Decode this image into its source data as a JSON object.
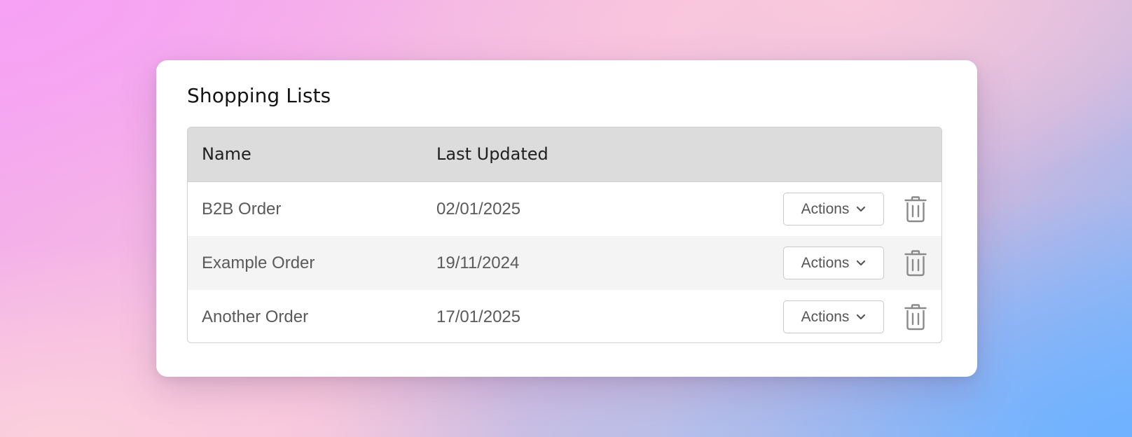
{
  "card": {
    "title": "Shopping Lists"
  },
  "table": {
    "columns": {
      "name": "Name",
      "last_updated": "Last Updated"
    },
    "rows": [
      {
        "name": "B2B Order",
        "last_updated": "02/01/2025",
        "action_label": "Actions"
      },
      {
        "name": "Example Order",
        "last_updated": "19/11/2024",
        "action_label": "Actions"
      },
      {
        "name": "Another Order",
        "last_updated": "17/01/2025",
        "action_label": "Actions"
      }
    ]
  },
  "icons": {
    "dropdown": "chevron-down-icon",
    "delete": "trash-icon"
  },
  "colors": {
    "card_background": "#ffffff",
    "header_background": "#dcdcdc",
    "alt_row_background": "#f4f4f4",
    "border": "#cfcfcf",
    "icon": "#8a8a8a"
  }
}
